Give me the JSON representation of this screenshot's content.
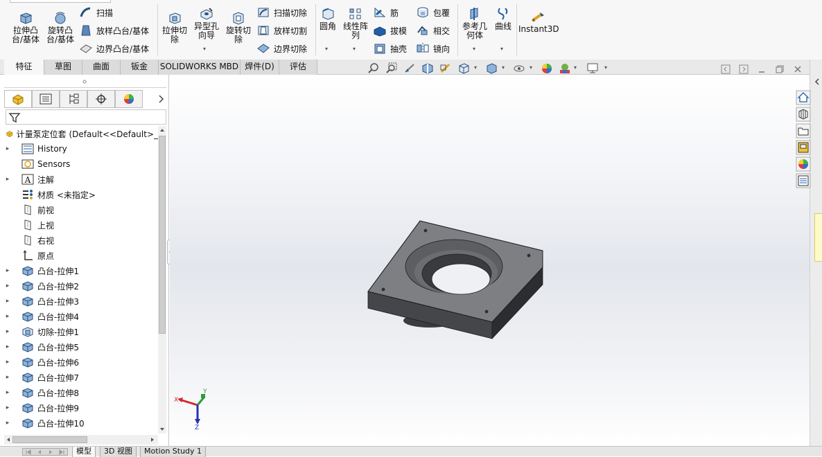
{
  "ribbon": {
    "extrude_boss": [
      "拉伸凸",
      "台/基体"
    ],
    "revolve_boss": [
      "旋转凸",
      "台/基体"
    ],
    "sweep": "扫描",
    "loft_boss": "放样凸台/基体",
    "boundary_boss": "边界凸台/基体",
    "extrude_cut": [
      "拉伸切",
      "除"
    ],
    "hole_wizard": [
      "异型孔",
      "向导"
    ],
    "revolve_cut": [
      "旋转切",
      "除"
    ],
    "swept_cut": "扫描切除",
    "lofted_cut": "放样切割",
    "boundary_cut": "边界切除",
    "fillet": "圆角",
    "linear_pattern": [
      "线性阵",
      "列"
    ],
    "rib": "筋",
    "draft": "拔模",
    "shell": "抽壳",
    "wrap": "包覆",
    "intersect": "相交",
    "mirror": "镜向",
    "ref_geometry": [
      "参考几",
      "何体"
    ],
    "curves": "曲线",
    "instant3d": "Instant3D",
    "caret": "▾"
  },
  "tabs": [
    "特征",
    "草图",
    "曲面",
    "钣金",
    "SOLIDWORKS MBD",
    "焊件(D)",
    "评估"
  ],
  "tree": {
    "root": "计量泵定位套  (Default<<Default>_",
    "items": [
      {
        "label": "History",
        "icon": "history-icon",
        "arrow": true
      },
      {
        "label": "Sensors",
        "icon": "sensors-icon",
        "arrow": false
      },
      {
        "label": "注解",
        "icon": "annotations-icon",
        "arrow": true
      },
      {
        "label": "材质 <未指定>",
        "icon": "material-icon",
        "arrow": false
      },
      {
        "label": "前视",
        "icon": "plane-icon",
        "arrow": false
      },
      {
        "label": "上视",
        "icon": "plane-icon",
        "arrow": false
      },
      {
        "label": "右视",
        "icon": "plane-icon",
        "arrow": false
      },
      {
        "label": "原点",
        "icon": "origin-icon",
        "arrow": false
      },
      {
        "label": "凸台-拉伸1",
        "icon": "boss-extrude-icon",
        "arrow": true
      },
      {
        "label": "凸台-拉伸2",
        "icon": "boss-extrude-icon",
        "arrow": true
      },
      {
        "label": "凸台-拉伸3",
        "icon": "boss-extrude-icon",
        "arrow": true
      },
      {
        "label": "凸台-拉伸4",
        "icon": "boss-extrude-icon",
        "arrow": true
      },
      {
        "label": "切除-拉伸1",
        "icon": "cut-extrude-icon",
        "arrow": true
      },
      {
        "label": "凸台-拉伸5",
        "icon": "boss-extrude-icon",
        "arrow": true
      },
      {
        "label": "凸台-拉伸6",
        "icon": "boss-extrude-icon",
        "arrow": true
      },
      {
        "label": "凸台-拉伸7",
        "icon": "boss-extrude-icon",
        "arrow": true
      },
      {
        "label": "凸台-拉伸8",
        "icon": "boss-extrude-icon",
        "arrow": true
      },
      {
        "label": "凸台-拉伸9",
        "icon": "boss-extrude-icon",
        "arrow": true
      },
      {
        "label": "凸台-拉伸10",
        "icon": "boss-extrude-icon",
        "arrow": true
      }
    ]
  },
  "triad": {
    "x": "X",
    "y": "Y",
    "z": "Z"
  },
  "bottom_tabs": [
    "模型",
    "3D 视图",
    "Motion Study 1"
  ],
  "colors": {
    "accent": "#1f5fa8",
    "part_top": "#7d7f83",
    "part_front": "#44464a",
    "part_side": "#2c2d30"
  }
}
